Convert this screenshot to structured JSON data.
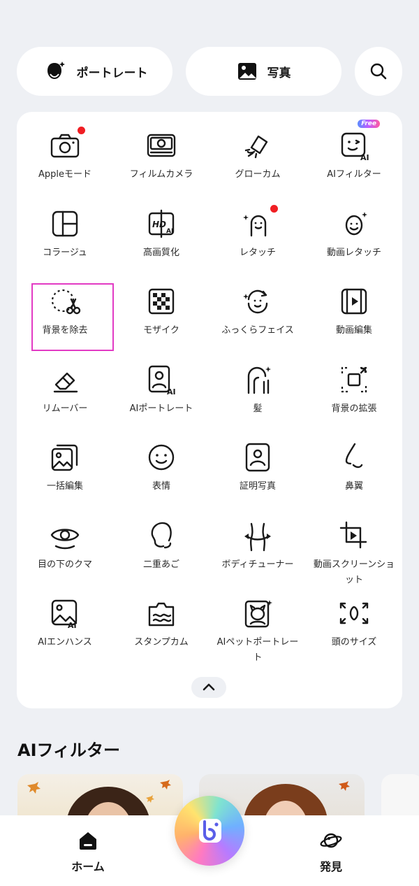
{
  "top_tabs": {
    "portrait_label": "ポートレート",
    "photo_label": "写真"
  },
  "tools": [
    {
      "name": "apple-mode",
      "label": "Appleモード",
      "icon": "camera-icon",
      "dot": true
    },
    {
      "name": "film-camera",
      "label": "フィルムカメラ",
      "icon": "film-camera-icon"
    },
    {
      "name": "glow-cam",
      "label": "グローカム",
      "icon": "spotlight-icon"
    },
    {
      "name": "ai-filter",
      "label": "AIフィルター",
      "icon": "ai-face-icon",
      "badge": "Free"
    },
    {
      "name": "collage",
      "label": "コラージュ",
      "icon": "collage-icon"
    },
    {
      "name": "hd-enhance",
      "label": "高画質化",
      "icon": "hd-icon"
    },
    {
      "name": "retouch",
      "label": "レタッチ",
      "icon": "retouch-face-icon",
      "dot": true
    },
    {
      "name": "video-retouch",
      "label": "動画レタッチ",
      "icon": "video-face-icon"
    },
    {
      "name": "remove-background",
      "label": "背景を除去",
      "icon": "scissors-icon"
    },
    {
      "name": "mosaic",
      "label": "モザイク",
      "icon": "mosaic-icon"
    },
    {
      "name": "plump-face",
      "label": "ふっくらフェイス",
      "icon": "plump-face-icon"
    },
    {
      "name": "video-edit",
      "label": "動画編集",
      "icon": "video-edit-icon"
    },
    {
      "name": "remover",
      "label": "リムーバー",
      "icon": "eraser-icon"
    },
    {
      "name": "ai-portrait",
      "label": "AIポートレート",
      "icon": "ai-portrait-icon"
    },
    {
      "name": "hair",
      "label": "髪",
      "icon": "hair-icon"
    },
    {
      "name": "expand-background",
      "label": "背景の拡張",
      "icon": "expand-icon"
    },
    {
      "name": "batch-edit",
      "label": "一括編集",
      "icon": "batch-icon"
    },
    {
      "name": "expression",
      "label": "表情",
      "icon": "smile-icon"
    },
    {
      "name": "id-photo",
      "label": "証明写真",
      "icon": "id-photo-icon"
    },
    {
      "name": "nose-wing",
      "label": "鼻翼",
      "icon": "nose-icon"
    },
    {
      "name": "dark-circles",
      "label": "目の下のクマ",
      "icon": "eye-icon"
    },
    {
      "name": "double-chin",
      "label": "二重あご",
      "icon": "chin-icon"
    },
    {
      "name": "body-tuner",
      "label": "ボディチューナー",
      "icon": "body-icon"
    },
    {
      "name": "video-screenshot",
      "label": "動画スクリーンショット",
      "icon": "crop-video-icon"
    },
    {
      "name": "ai-enhance",
      "label": "AIエンハンス",
      "icon": "ai-image-icon"
    },
    {
      "name": "stamp-cam",
      "label": "スタンプカム",
      "icon": "stamp-icon"
    },
    {
      "name": "ai-pet-portrait",
      "label": "AIペットポートレート",
      "icon": "pet-portrait-icon"
    },
    {
      "name": "head-size",
      "label": "頭のサイズ",
      "icon": "head-size-icon"
    }
  ],
  "section": {
    "ai_filter_title": "AIフィルター"
  },
  "bottom_nav": {
    "home_label": "ホーム",
    "discover_label": "発見"
  },
  "colors": {
    "accent_dot": "#f01e23",
    "highlight": "#e23bc4",
    "background": "#eef0f4"
  }
}
